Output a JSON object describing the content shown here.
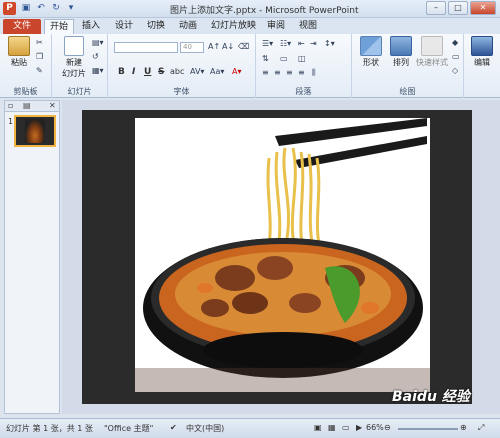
{
  "window": {
    "title": "图片上添加文字.pptx - Microsoft PowerPoint",
    "app_letter": "P"
  },
  "tabs": [
    "文件",
    "开始",
    "插入",
    "设计",
    "切换",
    "动画",
    "幻灯片放映",
    "审阅",
    "视图"
  ],
  "ribbon": {
    "clipboard": {
      "paste": "粘贴",
      "label": "剪贴板"
    },
    "slides": {
      "new_slide_l1": "新建",
      "new_slide_l2": "幻灯片",
      "label": "幻灯片"
    },
    "font": {
      "size": "40",
      "label": "字体",
      "bold": "B",
      "italic": "I",
      "underline": "U",
      "strike": "S",
      "shadow": "abc"
    },
    "paragraph": {
      "label": "段落"
    },
    "drawing": {
      "shape": "形状",
      "arrange": "排列",
      "quick_styles": "快速样式",
      "label": "绘图"
    },
    "editing": {
      "label": "编辑"
    }
  },
  "slide_panel": {
    "slide_number": "1"
  },
  "status_bar": {
    "slide_info": "幻灯片 第 1 张，共 1 张",
    "theme": "\"Office 主题\"",
    "language": "中文(中国)",
    "zoom": "66%"
  },
  "watermark": "Baidu 经验",
  "colors": {
    "file_tab": "#c9462d",
    "slide_bg": "#2b2b2b"
  }
}
